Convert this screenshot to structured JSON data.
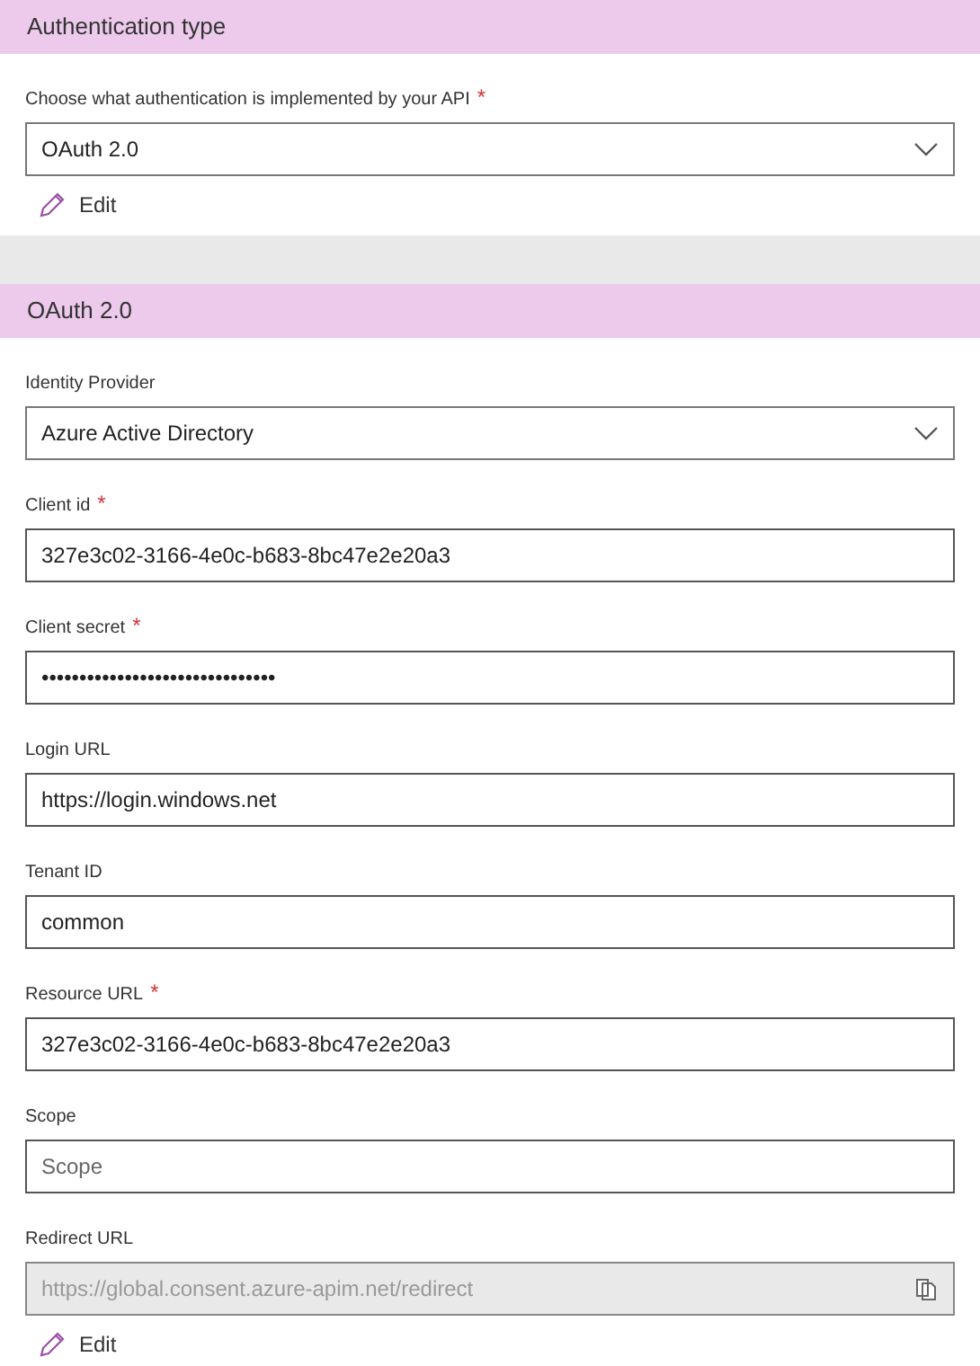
{
  "sections": [
    {
      "title": "Authentication type",
      "fields": [
        {
          "kind": "select",
          "label": "Choose what authentication is implemented by your API",
          "required_mark": "*",
          "value": "OAuth 2.0"
        }
      ],
      "edit": "Edit"
    },
    {
      "title": "OAuth 2.0",
      "fields": [
        {
          "kind": "select",
          "label": "Identity Provider",
          "value": "Azure Active Directory"
        },
        {
          "kind": "input",
          "label": "Client id",
          "required_mark": "*",
          "value": "327e3c02-3166-4e0c-b683-8bc47e2e20a3"
        },
        {
          "kind": "input",
          "label": "Client secret",
          "required_mark": "*",
          "value": "•••••••••••••••••••••••••••••••"
        },
        {
          "kind": "input",
          "label": "Login URL",
          "value": "https://login.windows.net"
        },
        {
          "kind": "input",
          "label": "Tenant ID",
          "value": "common"
        },
        {
          "kind": "input",
          "label": "Resource URL",
          "required_mark": "*",
          "value": "327e3c02-3166-4e0c-b683-8bc47e2e20a3"
        },
        {
          "kind": "input",
          "label": "Scope",
          "placeholder": "Scope"
        },
        {
          "kind": "readonly",
          "label": "Redirect URL",
          "value": "https://global.consent.azure-apim.net/redirect"
        }
      ],
      "edit": "Edit"
    }
  ]
}
